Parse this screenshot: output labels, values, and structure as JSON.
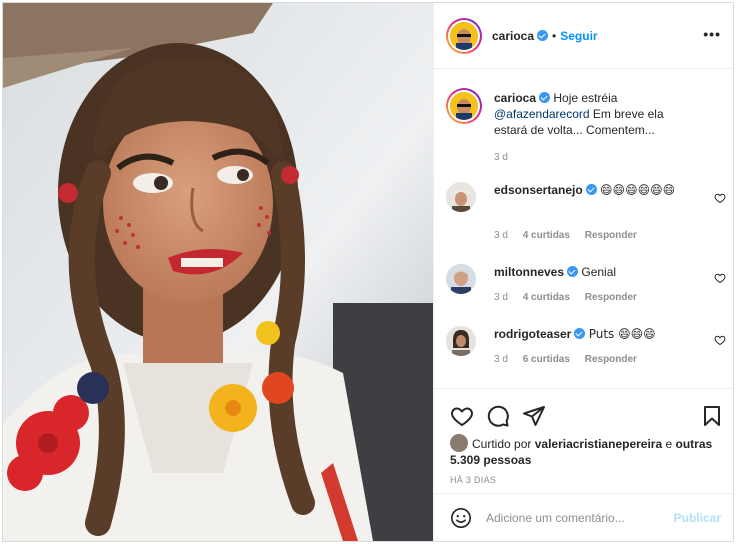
{
  "post": {
    "author": "carioca",
    "follow_label": "Seguir",
    "dot": "•",
    "more_label": "•••"
  },
  "caption": {
    "user": "carioca",
    "text_before": "Hoje estréia",
    "mention": "@afazendarecord",
    "text_after": "Em breve ela estará de volta... Comentem...",
    "time": "3 d"
  },
  "comments": [
    {
      "user": "edsonsertanejo",
      "text": "😄😄😄😄😄😄",
      "time": "3 d",
      "likes": "4 curtidas",
      "reply": "Responder"
    },
    {
      "user": "miltonneves",
      "text": "Genial",
      "time": "3 d",
      "likes": "4 curtidas",
      "reply": "Responder"
    },
    {
      "user": "rodrigoteaser",
      "text": "Puts 😄😄😄",
      "time": "3 d",
      "likes": "6 curtidas",
      "reply": "Responder"
    }
  ],
  "likes": {
    "prefix": "Curtido por",
    "user": "valeriacristianepereira",
    "middle": "e",
    "others": "outras 5.309 pessoas"
  },
  "posted_ago": "HÁ 3 DIAS",
  "add_comment": {
    "placeholder": "Adicione um comentário...",
    "publish_label": "Publicar"
  },
  "colors": {
    "accent": "#0095f6",
    "verified": "#3897f0",
    "publish_disabled": "#b2dffc",
    "muted": "#8e8e8e"
  },
  "icons": [
    "verified-badge-icon",
    "more-options-icon",
    "heart-icon",
    "comment-icon",
    "share-icon",
    "bookmark-icon",
    "emoji-icon"
  ]
}
